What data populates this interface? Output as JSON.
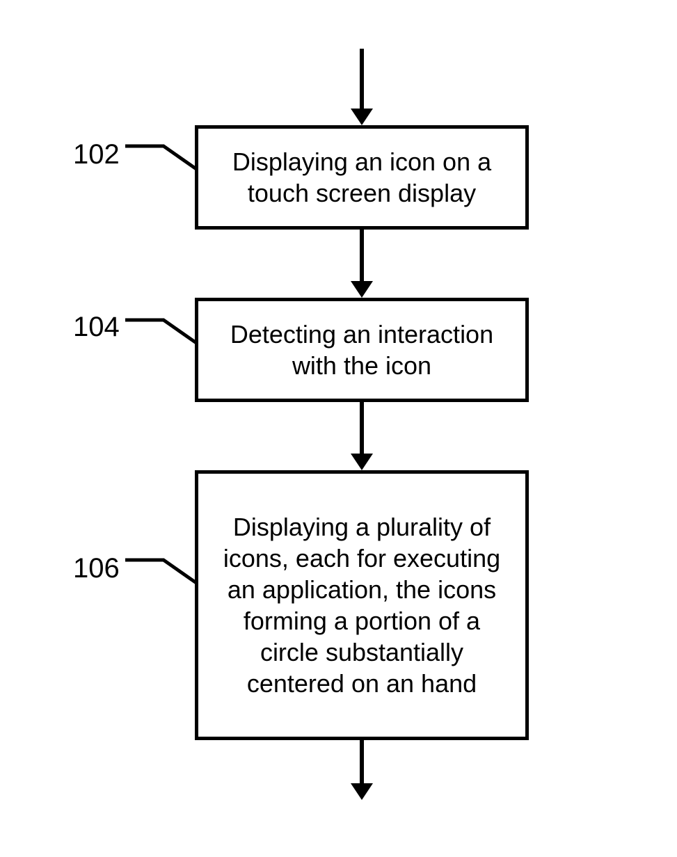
{
  "flow": {
    "labels": {
      "step1": "102",
      "step2": "104",
      "step3": "106"
    },
    "boxes": {
      "step1": "Displaying an icon on a touch screen display",
      "step2": "Detecting an interaction with the icon",
      "step3": "Displaying a plurality of icons, each for executing an application, the icons forming a portion of a circle substantially centered on an hand"
    }
  }
}
